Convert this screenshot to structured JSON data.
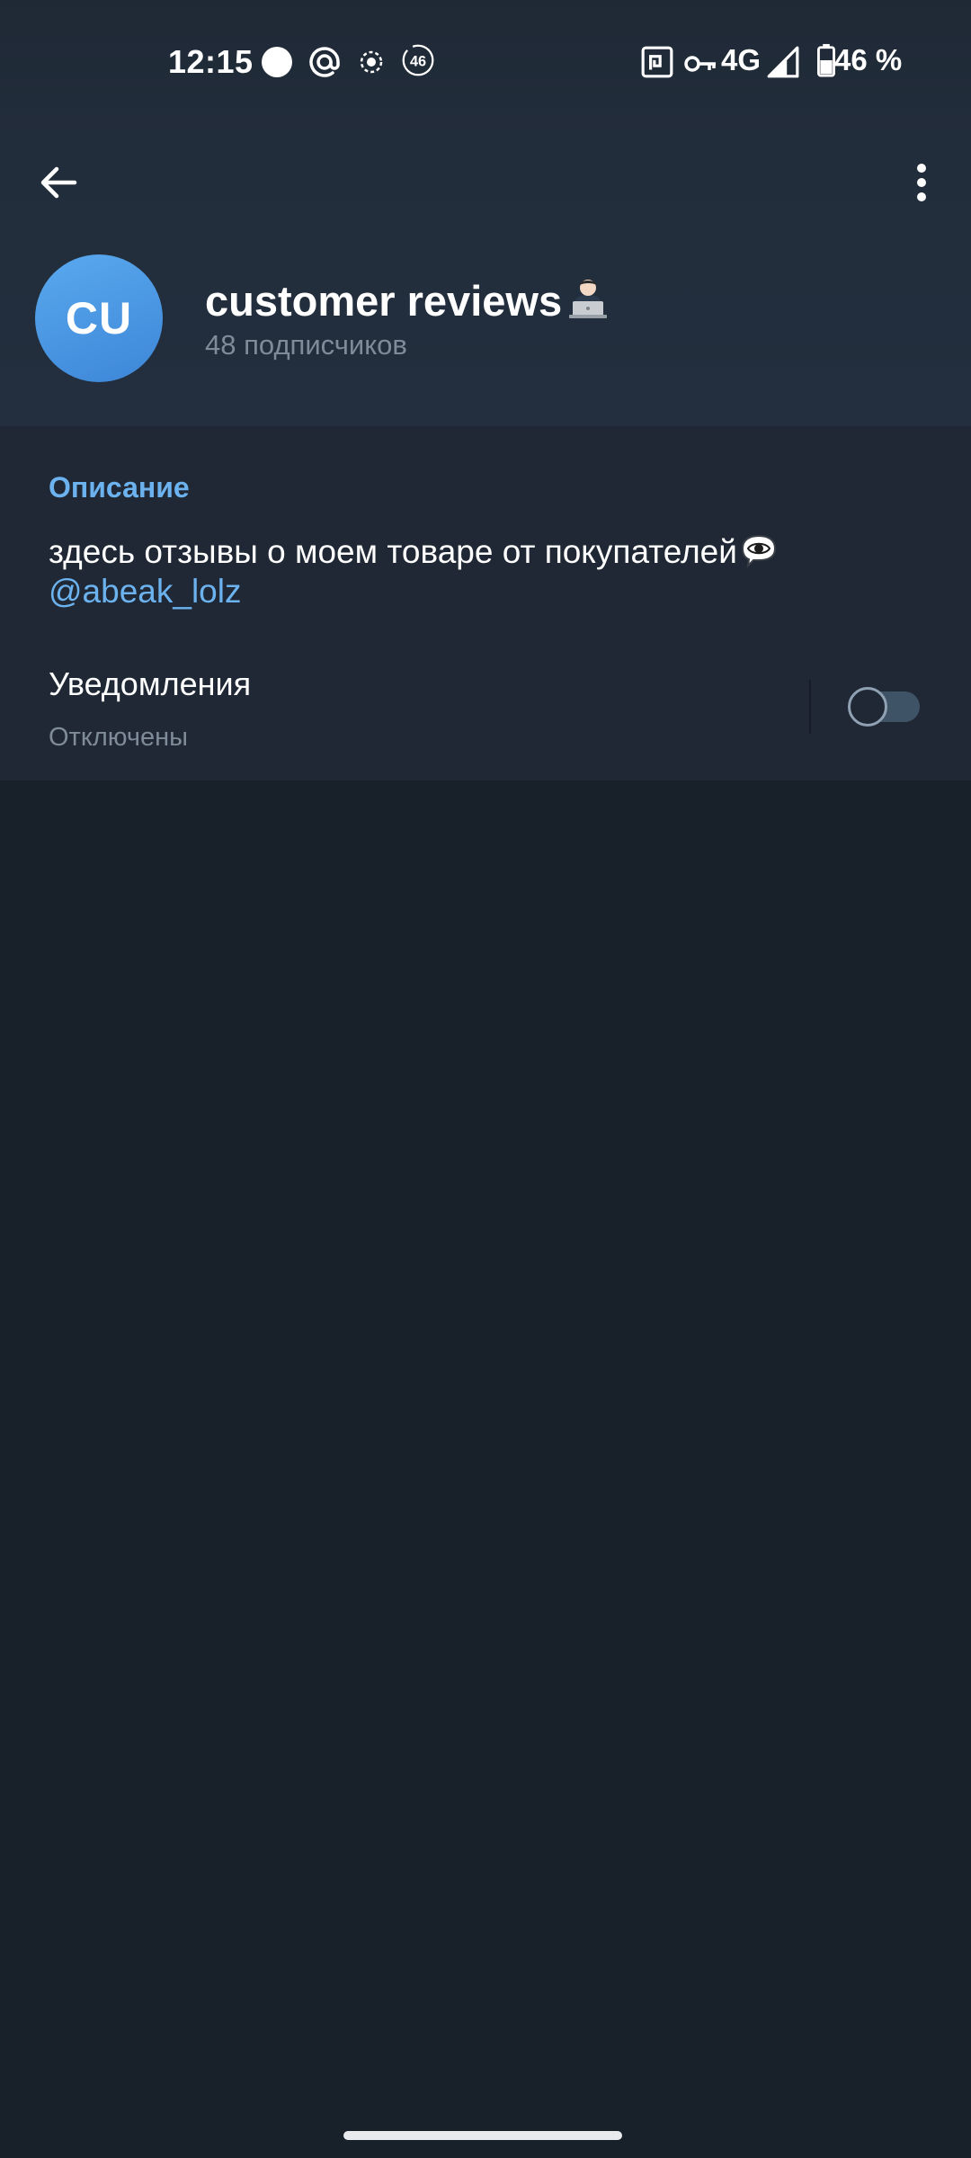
{
  "status_bar": {
    "time": "12:15",
    "icons": [
      "record-dot-icon",
      "at-sign-icon",
      "focus-icon",
      "speed-46-icon",
      "nfc-icon",
      "key-icon",
      "signal-icon",
      "battery-icon"
    ],
    "speed_badge": "46",
    "network": "4G",
    "battery": "46 %"
  },
  "app_bar": {
    "back_icon": "arrow-left-icon",
    "menu_icon": "more-vertical-icon"
  },
  "channel": {
    "initials": "CU",
    "title": "customer reviews",
    "title_emoji": "technologist-emoji",
    "subscribers": "48 подписчиков",
    "avatar_color": "#4a98e4"
  },
  "info": {
    "description_label": "Описание",
    "description_text": "здесь отзывы о моем товаре от покупателей",
    "description_emoji": "eye-in-speech-bubble-emoji",
    "mention": "@abeak_lolz",
    "notifications_label": "Уведомления",
    "notifications_status": "Отключены",
    "notifications_enabled": false
  },
  "colors": {
    "accent": "#6cb2ef",
    "background": "#18202a",
    "section": "#1f2834",
    "secondary_text": "#7f8b98"
  }
}
